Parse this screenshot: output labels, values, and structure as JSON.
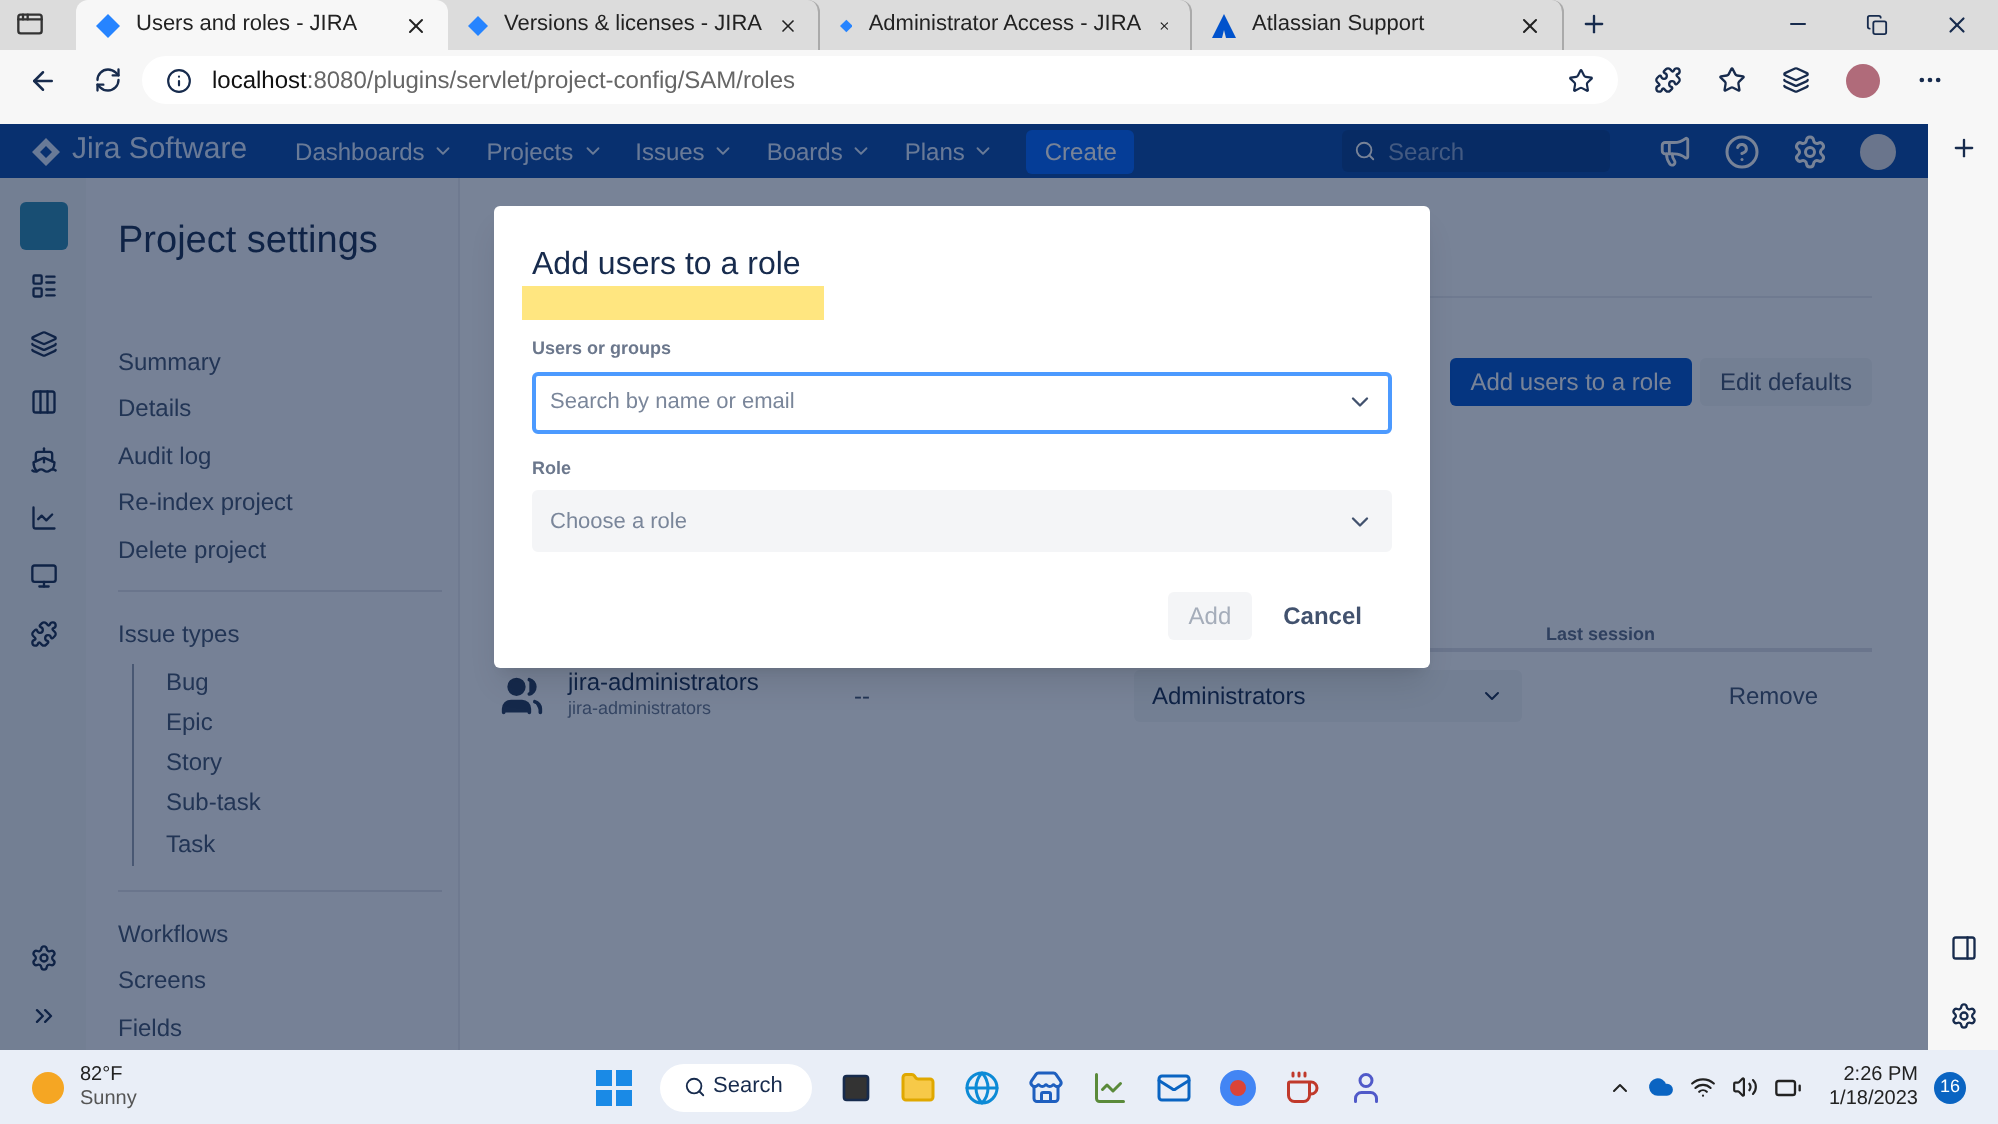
{
  "browser": {
    "tabs": [
      {
        "label": "Users and roles - JIRA",
        "selected": true
      },
      {
        "label": "Versions & licenses - JIRA",
        "selected": false
      },
      {
        "label": "Administrator Access - JIRA",
        "selected": false
      },
      {
        "label": "Atlassian Support",
        "selected": false
      }
    ],
    "url_host": "localhost",
    "url_rest": ":8080/plugins/servlet/project-config/SAM/roles"
  },
  "header": {
    "logo": "Jira Software",
    "menus": [
      "Dashboards",
      "Projects",
      "Issues",
      "Boards",
      "Plans"
    ],
    "create": "Create",
    "search_placeholder": "Search"
  },
  "sidebar": {
    "title": "Project settings",
    "groups": [
      {
        "items": [
          {
            "label": "Summary"
          },
          {
            "label": "Details"
          },
          {
            "label": "Audit log"
          },
          {
            "label": "Re-index project"
          },
          {
            "label": "Delete project"
          }
        ]
      },
      {
        "items": [
          {
            "label": "Issue types",
            "children": [
              {
                "label": "Bug"
              },
              {
                "label": "Epic"
              },
              {
                "label": "Story"
              },
              {
                "label": "Sub-task"
              },
              {
                "label": "Task"
              }
            ]
          }
        ]
      },
      {
        "items": [
          {
            "label": "Workflows"
          },
          {
            "label": "Screens"
          },
          {
            "label": "Fields"
          }
        ]
      }
    ]
  },
  "main": {
    "buttons": [
      {
        "label": "Add users to a role",
        "kind": "primary"
      },
      {
        "label": "Edit defaults",
        "kind": "subtle"
      }
    ],
    "table": {
      "column_4": "Last session",
      "rows": [
        {
          "name": "jira-administrators",
          "sub": "jira-administrators",
          "column_2": "--",
          "role": "Administrators",
          "action": "Remove"
        }
      ]
    }
  },
  "dialog": {
    "title": "Add users to a role",
    "fields": [
      {
        "label": "Users or groups",
        "placeholder": "Search by name or email",
        "focused": true
      },
      {
        "label": "Role",
        "placeholder": "Choose a role",
        "focused": false
      }
    ],
    "buttons": [
      {
        "label": "Add",
        "disabled": true
      },
      {
        "label": "Cancel",
        "disabled": false
      }
    ]
  },
  "taskbar": {
    "weather_temp": "82°F",
    "weather_text": "Sunny",
    "search": "Search",
    "time": "2:26 PM",
    "date": "1/18/2023",
    "badge": "16"
  }
}
